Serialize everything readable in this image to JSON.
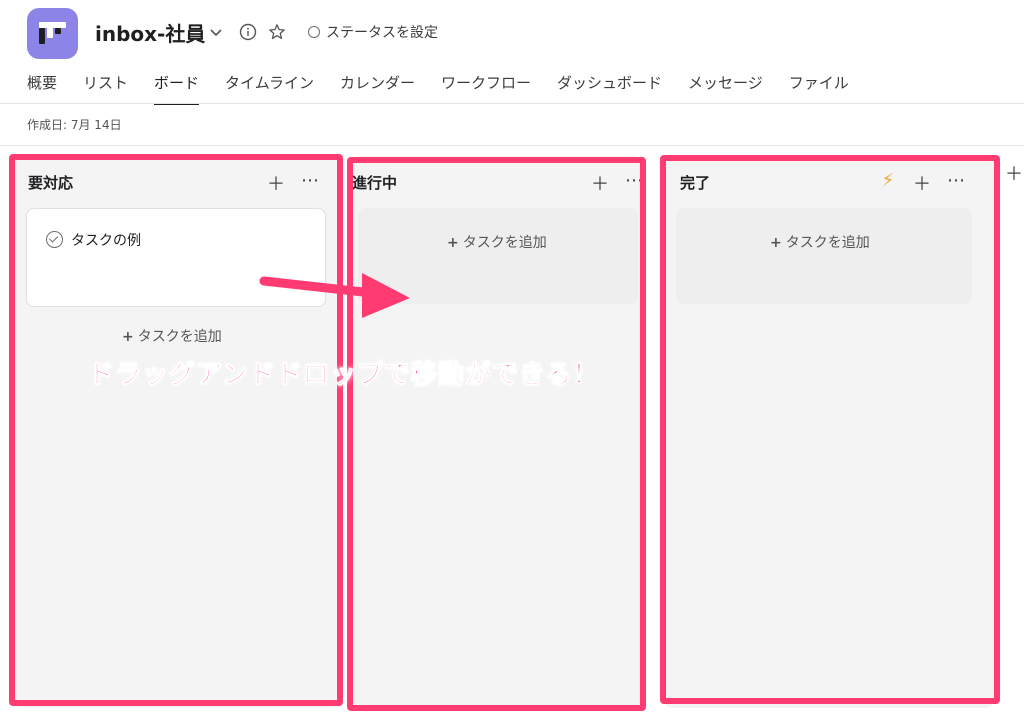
{
  "header": {
    "project_title": "inbox-社員",
    "status_label": "ステータスを設定"
  },
  "tabs": [
    {
      "label": "概要"
    },
    {
      "label": "リスト"
    },
    {
      "label": "ボード",
      "active": true
    },
    {
      "label": "タイムライン"
    },
    {
      "label": "カレンダー"
    },
    {
      "label": "ワークフロー"
    },
    {
      "label": "ダッシュボード"
    },
    {
      "label": "メッセージ"
    },
    {
      "label": "ファイル"
    }
  ],
  "meta": {
    "created": "作成日: 7月 14日"
  },
  "board": {
    "add_task_label": "タスクを追加",
    "columns": [
      {
        "title": "要対応",
        "tasks": [
          {
            "title": "タスクの例"
          }
        ]
      },
      {
        "title": "進行中",
        "tasks": []
      },
      {
        "title": "完了",
        "tasks": []
      }
    ]
  },
  "annotation": {
    "text": "ドラッグアンドドロップで移動ができる！",
    "color": "#ff3b72"
  },
  "icons": {
    "dropdown": "chevron-down-icon",
    "info": "info-icon",
    "favorite": "star-icon",
    "rule": "lightning-icon",
    "add": "plus-icon",
    "more": "more-icon"
  },
  "colors": {
    "project_icon": "#8d84e8",
    "highlight": "#ff3b72",
    "rule_icon": "#f1a73a"
  }
}
